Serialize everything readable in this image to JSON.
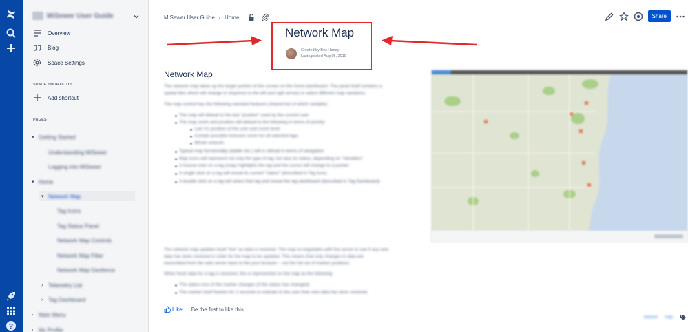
{
  "sidebar": {
    "space_name": "MiSewer User Guide",
    "nav": [
      {
        "label": "Overview",
        "icon": "overview-icon"
      },
      {
        "label": "Blog",
        "icon": "quote-icon"
      },
      {
        "label": "Space Settings",
        "icon": "gear-icon"
      }
    ],
    "shortcuts_label": "SPACE SHORTCUTS",
    "add_shortcut": "Add shortcut",
    "pages_label": "PAGES",
    "tree": [
      {
        "label": "Getting Started",
        "level": 0,
        "caret": "▾"
      },
      {
        "label": "Understanding MiSewer",
        "level": 1,
        "caret": ""
      },
      {
        "label": "Logging into MiSewer",
        "level": 1,
        "caret": ""
      },
      {
        "label": "Home",
        "level": 0,
        "caret": "▾"
      },
      {
        "label": "Network Map",
        "level": 1,
        "caret": "▾",
        "current": true
      },
      {
        "label": "Tag Icons",
        "level": 2,
        "caret": ""
      },
      {
        "label": "Tag Status Panel",
        "level": 2,
        "caret": ""
      },
      {
        "label": "Network Map Controls",
        "level": 2,
        "caret": ""
      },
      {
        "label": "Network Map Filter",
        "level": 2,
        "caret": ""
      },
      {
        "label": "Network Map Geofence",
        "level": 2,
        "caret": ""
      },
      {
        "label": "Telemetry List",
        "level": 1,
        "caret": "›"
      },
      {
        "label": "Tag Dashboard",
        "level": 1,
        "caret": "›"
      },
      {
        "label": "Main Menu",
        "level": 0,
        "caret": "›"
      },
      {
        "label": "My Profile",
        "level": 0,
        "caret": "›"
      }
    ]
  },
  "breadcrumb": [
    "MiSewer User Guide",
    "Home"
  ],
  "topbar": {
    "share_label": "Share"
  },
  "page": {
    "title": "Network Map",
    "created_by": "Created by Bec Honey",
    "last_updated": "Last updated Aug 05, 2019",
    "section_heading": "Network Map"
  },
  "body_lines": [
    {
      "text": "The network map takes up the larger portion of the screen on the home dashboard. The panel itself contains a"
    },
    {
      "text": "spatial tiles which will change in response to the left and right arrows to select different map variations."
    },
    {
      "text": "The map control has the following standard features (shared but of which variable):"
    },
    {
      "text": "The map will default to the last \"position\" used by the current user",
      "bullet": true
    },
    {
      "text": "The map zoom and position will default to the following in terms of priority:",
      "bullet": true
    },
    {
      "text": "Last X1 position of the user and zoom level",
      "bullet": true,
      "indent": true
    },
    {
      "text": "Contain possible inclusion zoom for all selected tags",
      "bullet": true,
      "indent": true
    },
    {
      "text": "Whole network",
      "bullet": true,
      "indent": true
    },
    {
      "text": "Typical map functionality (ladder etc.) will is utilised in terms of navigation",
      "bullet": true
    },
    {
      "text": "Map icons will represent not only the type of tag, but also its status, depending on \"Variables\"",
      "bullet": true
    },
    {
      "text": "A mouse-over on a tag (map) highlights the tag and the cursor will change to a pointer",
      "bullet": true
    },
    {
      "text": "A single click on a tag will reveal its current \"status\" (described in Tag Icon)",
      "bullet": true
    },
    {
      "text": "A double click on a tag will select that tag and reveal the tag dashboard (described in Tag Dashboard)",
      "bullet": true
    },
    {
      "text": "The network map updates itself \"live\" as data is received. The map re-negotiates with the server to see if any new"
    },
    {
      "text": "data has been received in order for the map to be updated. This means that only changes in data are"
    },
    {
      "text": "transmitted from the web server back to the your browser – not the full set of marker positions."
    },
    {
      "text": "When fresh data for a tag is received, this is represented on the map as the following:"
    },
    {
      "text": "The status icon of the marker changes (if the status has changed)",
      "bullet": true
    },
    {
      "text": "The marker itself flashes for 2 seconds to indicate to the user than new data has been received",
      "bullet": true
    }
  ],
  "like": {
    "label": "Like",
    "first_text": "Be the first to like this"
  },
  "footer_links": [
    "network",
    "map"
  ],
  "colors": {
    "global_nav": "#0747a6",
    "accent": "#0052cc",
    "highlight_box": "#e3282c"
  }
}
